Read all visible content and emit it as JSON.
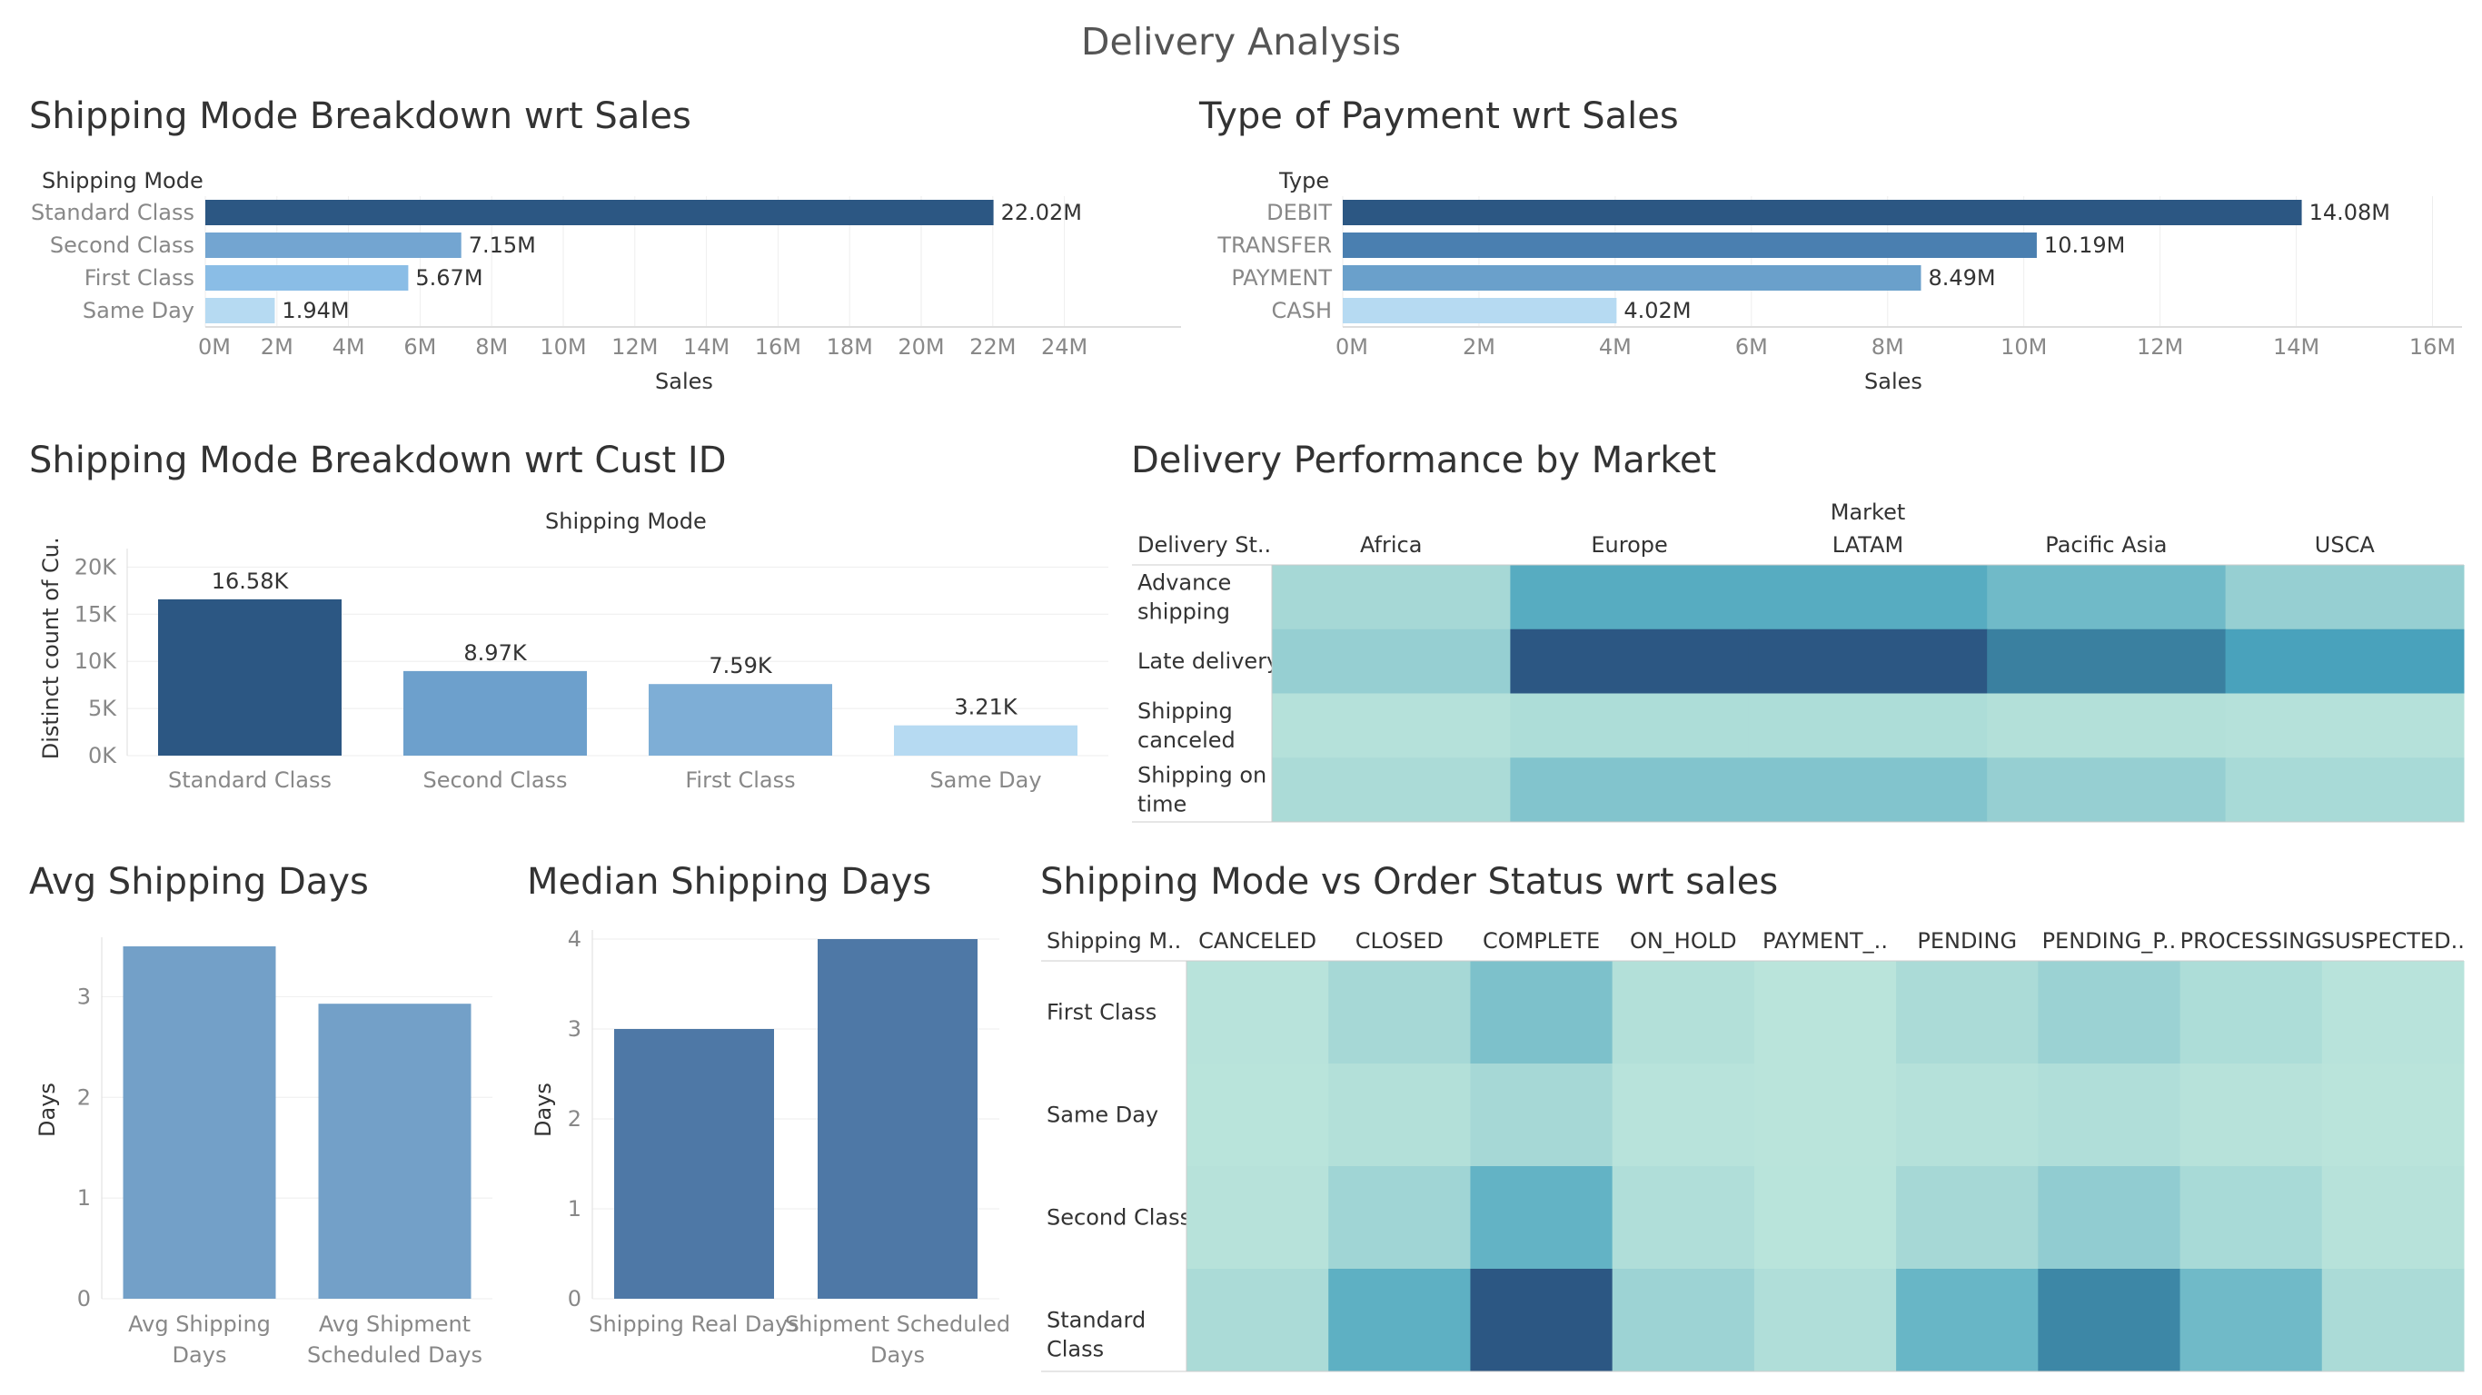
{
  "dashboard": {
    "title": "Delivery Analysis"
  },
  "chart_data": [
    {
      "id": "sales_by_mode",
      "type": "bar",
      "orientation": "horizontal",
      "title": "Shipping Mode Breakdown wrt Sales",
      "row_header": "Shipping Mode",
      "categories": [
        "Standard Class",
        "Second Class",
        "First Class",
        "Same Day"
      ],
      "values": [
        22.02,
        7.15,
        5.67,
        1.94
      ],
      "value_labels": [
        "22.02M",
        "7.15M",
        "5.67M",
        "1.94M"
      ],
      "colors": [
        "#2c5783",
        "#73a5d1",
        "#8abde6",
        "#b6daf2"
      ],
      "xlabel": "Sales",
      "xlim": [
        0,
        25
      ],
      "ticks": [
        0,
        2,
        4,
        6,
        8,
        10,
        12,
        14,
        16,
        18,
        20,
        22,
        24
      ],
      "tick_labels": [
        "0M",
        "2M",
        "4M",
        "6M",
        "8M",
        "10M",
        "12M",
        "14M",
        "16M",
        "18M",
        "20M",
        "22M",
        "24M"
      ],
      "grid": true
    },
    {
      "id": "sales_by_payment",
      "type": "bar",
      "orientation": "horizontal",
      "title": "Type of Payment wrt Sales",
      "row_header": "Type",
      "categories": [
        "DEBIT",
        "TRANSFER",
        "PAYMENT",
        "CASH"
      ],
      "values": [
        14.08,
        10.19,
        8.49,
        4.02
      ],
      "value_labels": [
        "14.08M",
        "10.19M",
        "8.49M",
        "4.02M"
      ],
      "colors": [
        "#2c5783",
        "#4a7fb0",
        "#6aa0cb",
        "#b6daf2"
      ],
      "xlabel": "Sales",
      "xlim": [
        0,
        16.3
      ],
      "ticks": [
        0,
        2,
        4,
        6,
        8,
        10,
        12,
        14,
        16
      ],
      "tick_labels": [
        "0M",
        "2M",
        "4M",
        "6M",
        "8M",
        "10M",
        "12M",
        "14M",
        "16M"
      ],
      "grid": true
    },
    {
      "id": "cust_by_mode",
      "type": "bar",
      "orientation": "vertical",
      "title": "Shipping Mode Breakdown wrt Cust ID",
      "column_header": "Shipping Mode",
      "categories": [
        "Standard Class",
        "Second Class",
        "First Class",
        "Same Day"
      ],
      "values": [
        16.58,
        8.97,
        7.59,
        3.21
      ],
      "value_labels": [
        "16.58K",
        "8.97K",
        "7.59K",
        "3.21K"
      ],
      "colors": [
        "#2c5783",
        "#6da0cc",
        "#7eaed6",
        "#b6daf2"
      ],
      "ylabel": "Distinct count of Cu..",
      "ylim": [
        0,
        21
      ],
      "ticks": [
        0,
        5,
        10,
        15,
        20
      ],
      "tick_labels": [
        "0K",
        "5K",
        "10K",
        "15K",
        "20K"
      ],
      "grid": true
    },
    {
      "id": "market_heatmap",
      "type": "heatmap",
      "title": "Delivery Performance by Market",
      "column_group_label": "Market",
      "row_header": "Delivery St..",
      "columns": [
        "Africa",
        "Europe",
        "LATAM",
        "Pacific Asia",
        "USCA"
      ],
      "rows": [
        "Advance shipping",
        "Late delivery",
        "Shipping canceled",
        "Shipping on time"
      ],
      "values": [
        [
          0.18,
          0.55,
          0.55,
          0.45,
          0.3
        ],
        [
          0.3,
          1.0,
          1.0,
          0.85,
          0.62
        ],
        [
          0.06,
          0.12,
          0.12,
          0.08,
          0.06
        ],
        [
          0.14,
          0.38,
          0.38,
          0.3,
          0.16
        ]
      ]
    },
    {
      "id": "avg_days",
      "type": "bar",
      "orientation": "vertical",
      "title": "Avg Shipping Days",
      "categories": [
        "Avg Shipping Days",
        "Avg Shipment Scheduled Days"
      ],
      "values": [
        3.5,
        2.93
      ],
      "colors": [
        "#73a0c8",
        "#73a0c8"
      ],
      "ylabel": "Days",
      "ylim": [
        0,
        3.5
      ],
      "ticks": [
        0,
        1,
        2,
        3
      ],
      "grid": true
    },
    {
      "id": "median_days",
      "type": "bar",
      "orientation": "vertical",
      "title": "Median Shipping Days",
      "categories": [
        "Shipping Real Days",
        "Shipment Scheduled Days"
      ],
      "values": [
        3,
        4
      ],
      "colors": [
        "#4e78a6",
        "#4e78a6"
      ],
      "ylabel": "Days",
      "ylim": [
        0,
        4
      ],
      "ticks": [
        0,
        1,
        2,
        3,
        4
      ],
      "grid": true
    },
    {
      "id": "status_heatmap",
      "type": "heatmap",
      "title": "Shipping Mode vs Order Status wrt sales",
      "row_header": "Shipping M..",
      "columns": [
        "CANCELED",
        "CLOSED",
        "COMPLETE",
        "ON_HOLD",
        "PAYMENT_..",
        "PENDING",
        "PENDING_P..",
        "PROCESSING",
        "SUSPECTED.."
      ],
      "rows": [
        "First Class",
        "Same Day",
        "Second Class",
        "Standard Class"
      ],
      "values": [
        [
          0.04,
          0.18,
          0.4,
          0.08,
          0.02,
          0.14,
          0.26,
          0.12,
          0.04
        ],
        [
          0.03,
          0.08,
          0.18,
          0.04,
          0.02,
          0.06,
          0.1,
          0.05,
          0.02
        ],
        [
          0.05,
          0.22,
          0.5,
          0.1,
          0.03,
          0.18,
          0.32,
          0.16,
          0.05
        ],
        [
          0.14,
          0.52,
          1.0,
          0.25,
          0.1,
          0.48,
          0.8,
          0.45,
          0.14
        ]
      ]
    }
  ]
}
